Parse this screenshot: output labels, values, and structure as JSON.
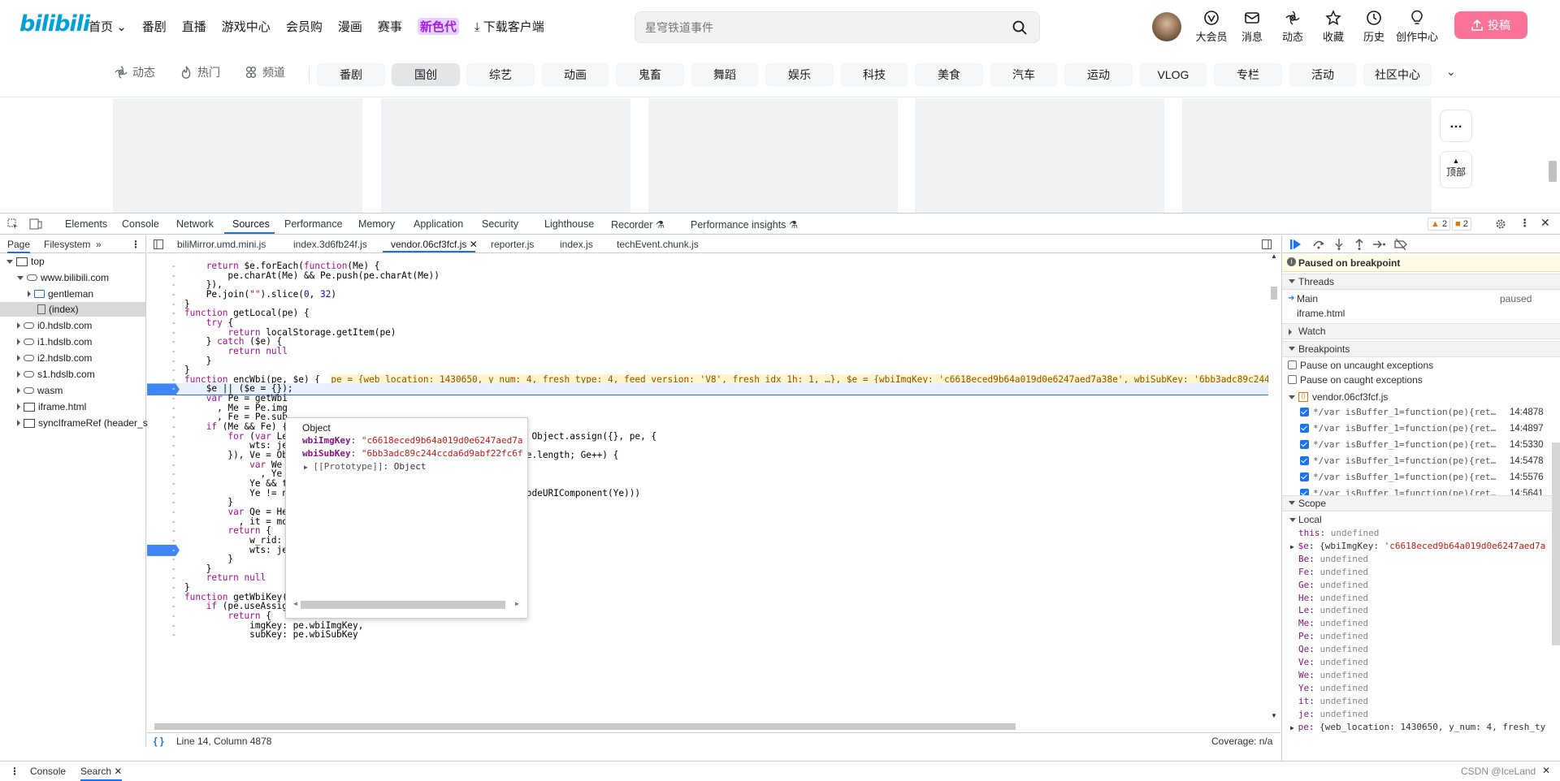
{
  "bili": {
    "logo": "bilibili",
    "nav": [
      "首页",
      "番剧",
      "直播",
      "游戏中心",
      "会员购",
      "漫画",
      "赛事",
      "新色代",
      "下载客户端"
    ],
    "search_placeholder": "星穹铁道事件",
    "right_icons": [
      {
        "label": "大会员",
        "icon": "vip-icon"
      },
      {
        "label": "消息",
        "icon": "message-icon"
      },
      {
        "label": "动态",
        "icon": "dynamic-icon"
      },
      {
        "label": "收藏",
        "icon": "star-icon"
      },
      {
        "label": "历史",
        "icon": "clock-icon"
      },
      {
        "label": "创作中心",
        "icon": "bulb-icon"
      }
    ],
    "upload_label": "投稿",
    "channels": [
      {
        "label": "动态",
        "icon": "dynamic-icon"
      },
      {
        "label": "热门",
        "icon": "fire-icon"
      },
      {
        "label": "频道",
        "icon": "channel-icon"
      }
    ],
    "pills": [
      "番剧",
      "国创",
      "综艺",
      "动画",
      "鬼畜",
      "舞蹈",
      "娱乐",
      "科技",
      "美食",
      "汽车",
      "运动",
      "VLOG",
      "专栏",
      "活动",
      "社区中心"
    ],
    "side_more": "…",
    "side_top": "顶部"
  },
  "devtools": {
    "tabs": [
      "Elements",
      "Console",
      "Network",
      "Sources",
      "Performance",
      "Memory",
      "Application",
      "Security",
      "Lighthouse",
      "Recorder",
      "Performance insights"
    ],
    "warnings": "2",
    "issues": "2",
    "nav_tabs": [
      "Page",
      "Filesystem"
    ],
    "tree": [
      "top",
      "www.bilibili.com",
      "gentleman",
      "(index)",
      "i0.hdslb.com",
      "i1.hdslb.com",
      "i2.hdslb.com",
      "s1.hdslb.com",
      "wasm",
      "iframe.html",
      "syncIframeRef (header_s"
    ],
    "files": [
      "biliMirror.umd.mini.js",
      "index.3d6fb24f.js",
      "vendor.06cf3fcf.js",
      "reporter.js",
      "index.js",
      "techEvent.chunk.js"
    ],
    "status": "Line 14, Column 4878",
    "coverage": "Coverage: n/a",
    "popover": {
      "title": "Object",
      "rows": [
        {
          "k": "wbiImgKey",
          "v": "\"c6618eced9b64a019d0e6247aed7a"
        },
        {
          "k": "wbiSubKey",
          "v": "\"6bb3adc89c244ccda6d9abf22fc6f"
        },
        {
          "k": "[[Prototype]]",
          "v": "Object"
        }
      ]
    },
    "debugger": {
      "paused": "Paused on breakpoint",
      "threads_title": "Threads",
      "threads": [
        {
          "name": "Main",
          "state": "paused"
        },
        {
          "name": "iframe.html",
          "state": ""
        }
      ],
      "watch_title": "Watch",
      "breakpoints_title": "Breakpoints",
      "pause_uncaught": "Pause on uncaught exceptions",
      "pause_caught": "Pause on caught exceptions",
      "bp_file": "vendor.06cf3fcf.js",
      "bps": [
        {
          "text": "*/var isBuffer_1=function(pe){ret…",
          "line": "14:4878"
        },
        {
          "text": "*/var isBuffer_1=function(pe){ret…",
          "line": "14:4897"
        },
        {
          "text": "*/var isBuffer_1=function(pe){ret…",
          "line": "14:5330"
        },
        {
          "text": "*/var isBuffer_1=function(pe){ret…",
          "line": "14:5478"
        },
        {
          "text": "*/var isBuffer_1=function(pe){ret…",
          "line": "14:5576"
        },
        {
          "text": "*/var isBuffer_1=function(pe){ret…",
          "line": "14:5641"
        }
      ],
      "scope_title": "Scope",
      "local_title": "Local",
      "scope": [
        {
          "k": "this",
          "v": "undefined"
        },
        {
          "k": "$e",
          "v": "{wbiImgKey: 'c6618eced9b64a019d0e6247aed7a"
        },
        {
          "k": "Be",
          "v": "undefined"
        },
        {
          "k": "Fe",
          "v": "undefined"
        },
        {
          "k": "Ge",
          "v": "undefined"
        },
        {
          "k": "He",
          "v": "undefined"
        },
        {
          "k": "Le",
          "v": "undefined"
        },
        {
          "k": "Me",
          "v": "undefined"
        },
        {
          "k": "Pe",
          "v": "undefined"
        },
        {
          "k": "Qe",
          "v": "undefined"
        },
        {
          "k": "Ve",
          "v": "undefined"
        },
        {
          "k": "We",
          "v": "undefined"
        },
        {
          "k": "Ye",
          "v": "undefined"
        },
        {
          "k": "it",
          "v": "undefined"
        },
        {
          "k": "je",
          "v": "undefined"
        },
        {
          "k": "pe",
          "v": "{web_location: 1430650, y_num: 4, fresh_ty"
        }
      ]
    },
    "drawer": [
      "Console",
      "Search"
    ],
    "watermark": "CSDN @IceLand"
  },
  "code": [
    {
      "t": "    return $e.forEach(function(Me) {"
    },
    {
      "t": "        pe.charAt(Me) && Pe.push(pe.charAt(Me))"
    },
    {
      "t": "    }),"
    },
    {
      "t": "    Pe.join(\"\").slice(0, 32)"
    },
    {
      "t": "}"
    },
    {
      "t": "function getLocal(pe) {"
    },
    {
      "t": "    try {"
    },
    {
      "t": "        return localStorage.getItem(pe)"
    },
    {
      "t": "    } catch ($e) {"
    },
    {
      "t": "        return null"
    },
    {
      "t": "    }"
    },
    {
      "t": "}"
    },
    {
      "t": "function encWbi(pe, $e) {",
      "inline": "pe = {web_location: 1430650, y_num: 4, fresh_type: 4, feed_version: 'V8', fresh_idx_1h: 1, …}, $e = {wbiImgKey: 'c6618eced9b64a019d0e6247aed7a38e', wbiSubKey: '6bb3adc89c244c"
    },
    {
      "t": "    $e || ($e = {});",
      "bp": true,
      "cur": true
    },
    {
      "t": "    var Pe = getWbi"
    },
    {
      "t": "      , Me = Pe.img"
    },
    {
      "t": "      , Fe = Pe.sub"
    },
    {
      "t": "    if (Me && Fe) {"
    },
    {
      "t": "        for (var Le                         .now() / 1e3), Be = Object.assign({}, pe, {"
    },
    {
      "t": "            wts: je"
    },
    {
      "t": "        }), Ve = Ob                         ]/g, Ge = 0; Ge < Ve.length; Ge++) {"
    },
    {
      "t": "            var We"
    },
    {
      "t": "              , Ye"
    },
    {
      "t": "            Ye && t                         \"\")),"
    },
    {
      "t": "            Ye != n                         e), \"=\").concat(encodeURIComponent(Ye)))"
    },
    {
      "t": "        }"
    },
    {
      "t": "        var Qe = He"
    },
    {
      "t": "          , it = mo"
    },
    {
      "t": "        return {"
    },
    {
      "t": "            w_rid:"
    },
    {
      "t": "            wts: je",
      "bp": true
    },
    {
      "t": "        }"
    },
    {
      "t": "    }"
    },
    {
      "t": "    return null"
    },
    {
      "t": "}"
    },
    {
      "t": "function getWbiKey(pe) {"
    },
    {
      "t": "    if (pe.useAssignKey)"
    },
    {
      "t": "        return {"
    },
    {
      "t": "            imgKey: pe.wbiImgKey,"
    },
    {
      "t": "            subKey: pe.wbiSubKey"
    }
  ]
}
